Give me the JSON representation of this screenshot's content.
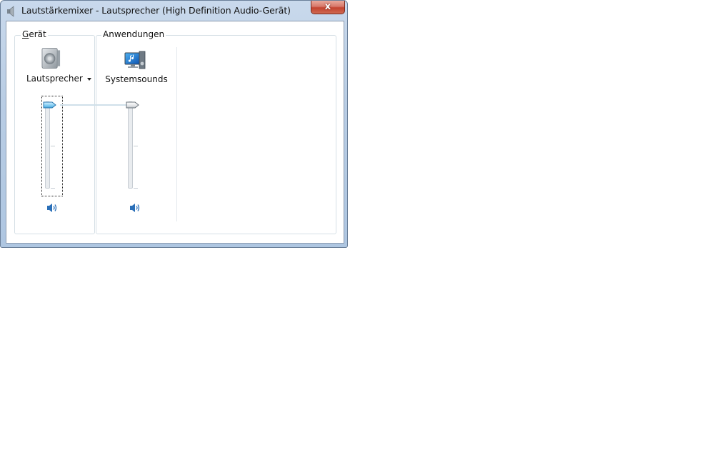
{
  "window": {
    "title": "Lautstärkemixer - Lautsprecher (High Definition Audio-Gerät)",
    "close_label": "x",
    "icon": "speaker-app-icon"
  },
  "device_group": {
    "label_first": "G",
    "label_rest": "erät",
    "device_name": "Lautsprecher",
    "device_icon": "speaker-device-icon",
    "volume_percent": 100,
    "muted": false
  },
  "apps_group": {
    "label": "Anwendungen",
    "apps": [
      {
        "name": "Systemsounds",
        "icon": "system-sounds-icon",
        "volume_percent": 100,
        "muted": false
      }
    ]
  },
  "colors": {
    "accent": "#3a8fd8",
    "title_bar": "#b9cde4",
    "close": "#c3432f"
  }
}
